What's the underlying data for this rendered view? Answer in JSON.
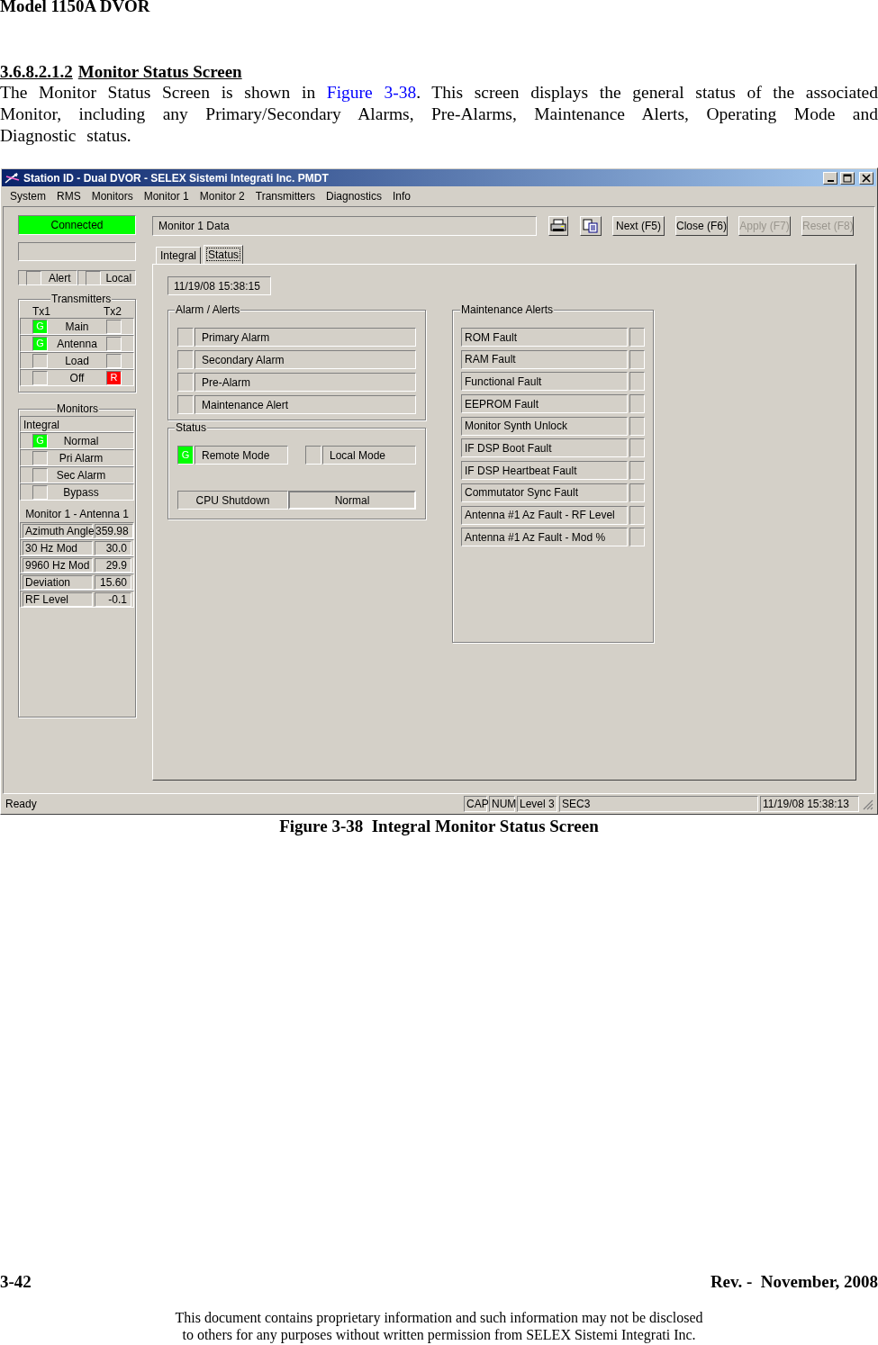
{
  "page_header": "Model 1150A DVOR",
  "section": {
    "number": "3.6.8.2.1.2",
    "title": "Monitor Status Screen"
  },
  "paragraph": {
    "before": "The Monitor Status Screen is shown in ",
    "link": "Figure 3-38",
    "after": ". This screen displays the general status of the associated Monitor, including any Primary/Secondary Alarms, Pre-Alarms, Maintenance Alerts, Operating Mode and Diagnostic status."
  },
  "window": {
    "title": "Station ID - Dual DVOR - SELEX Sistemi Integrati Inc. PMDT",
    "menu": [
      "System",
      "RMS",
      "Monitors",
      "Monitor 1",
      "Monitor 2",
      "Transmitters",
      "Diagnostics",
      "Info"
    ],
    "connection": {
      "label": "Connected",
      "connected": true
    },
    "flags": [
      {
        "label": "Alert"
      },
      {
        "label": "Local"
      }
    ],
    "transmitters": {
      "title": "Transmitters",
      "columns": [
        "Tx1",
        "Tx2"
      ],
      "rows": [
        {
          "label": "Main",
          "tx1": {
            "text": "G",
            "color": "#00ff00"
          }
        },
        {
          "label": "Antenna",
          "tx1": {
            "text": "G",
            "color": "#00ff00"
          }
        },
        {
          "label": "Load"
        },
        {
          "label": "Off",
          "tx2": {
            "text": "R",
            "color": "#ff0000"
          }
        }
      ]
    },
    "monitors": {
      "title": "Monitors",
      "subtitle": "Integral",
      "rows": [
        {
          "label": "Normal",
          "lamp": {
            "text": "G",
            "color": "#00ff00"
          }
        },
        {
          "label": "Pri Alarm"
        },
        {
          "label": "Sec Alarm"
        },
        {
          "label": "Bypass"
        }
      ],
      "reading_title": "Monitor 1 - Antenna 1",
      "readings": [
        {
          "label": "Azimuth Angle",
          "value": "359.98"
        },
        {
          "label": "30 Hz Mod",
          "value": "30.0"
        },
        {
          "label": "9960 Hz Mod",
          "value": "29.9"
        },
        {
          "label": "Deviation",
          "value": "15.60"
        },
        {
          "label": "RF Level",
          "value": "-0.1"
        }
      ]
    },
    "data_title": "Monitor 1 Data",
    "toolbar": [
      {
        "kind": "print",
        "disabled": false
      },
      {
        "kind": "copy",
        "disabled": false
      },
      {
        "kind": "text",
        "label": "Next (F5)",
        "disabled": false
      },
      {
        "kind": "text",
        "label": "Close (F6)",
        "disabled": false
      },
      {
        "kind": "text",
        "label": "Apply (F7)",
        "disabled": true
      },
      {
        "kind": "text",
        "label": "Reset (F8)",
        "disabled": true
      }
    ],
    "tabs": [
      {
        "label": "Integral",
        "selected": false
      },
      {
        "label": "Status",
        "selected": true
      }
    ],
    "timestamp": "11/19/08 15:38:15",
    "alarms": {
      "title": "Alarm / Alerts",
      "items": [
        {
          "label": "Primary Alarm"
        },
        {
          "label": "Secondary Alarm"
        },
        {
          "label": "Pre-Alarm"
        },
        {
          "label": "Maintenance Alert"
        }
      ]
    },
    "status": {
      "title": "Status",
      "modes": [
        {
          "label": "Remote Mode",
          "lamp": {
            "text": "G",
            "color": "#00ff00"
          }
        },
        {
          "label": "Local Mode"
        }
      ],
      "cpu": {
        "label": "CPU Shutdown",
        "value": "Normal"
      }
    },
    "maintenance": {
      "title": "Maintenance Alerts",
      "items": [
        {
          "label": "ROM Fault"
        },
        {
          "label": "RAM Fault"
        },
        {
          "label": "Functional Fault"
        },
        {
          "label": "EEPROM Fault"
        },
        {
          "label": "Monitor Synth Unlock"
        },
        {
          "label": "IF DSP Boot Fault"
        },
        {
          "label": "IF DSP Heartbeat Fault"
        },
        {
          "label": "Commutator Sync Fault"
        },
        {
          "label": "Antenna #1 Az Fault - RF Level"
        },
        {
          "label": "Antenna #1 Az Fault - Mod %"
        }
      ]
    },
    "status_bar": {
      "message": "Ready",
      "panes": [
        "CAP",
        "NUM",
        "Level 3",
        "SEC3"
      ],
      "time": "11/19/08 15:38:13"
    }
  },
  "caption": "Figure 3-38  Integral Monitor Status Screen",
  "footer": {
    "page": "3-42",
    "revision": "Rev. -  November, 2008",
    "notice": [
      "This document contains proprietary information and such information may not be disclosed",
      "to others for any purposes without written permission from SELEX Sistemi Integrati Inc."
    ]
  }
}
